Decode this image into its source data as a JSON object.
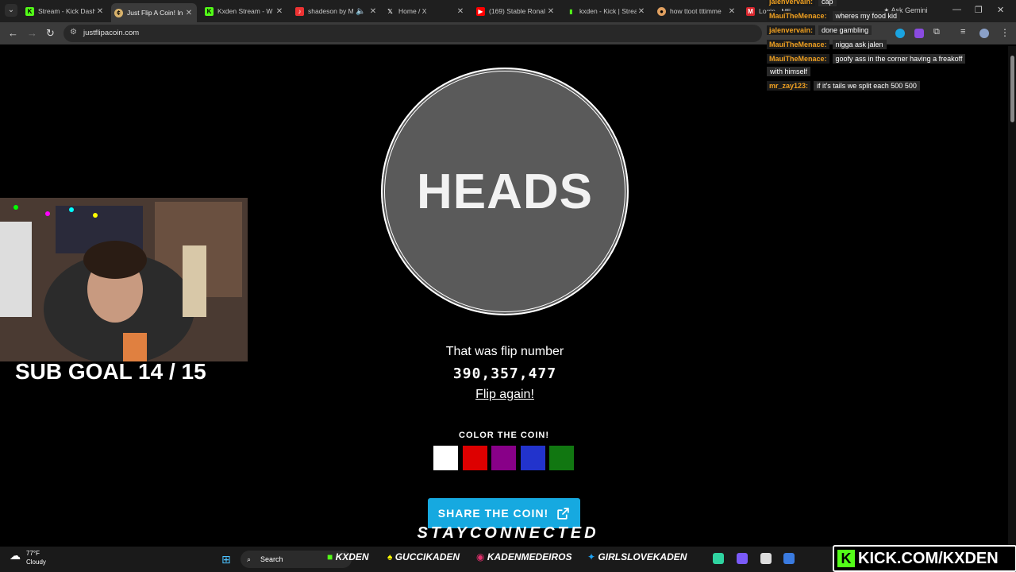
{
  "browser": {
    "tabs": [
      {
        "title": "Stream - Kick Dash",
        "icon": "kick-icon",
        "color": "#53fc18"
      },
      {
        "title": "Just Flip A Coin! In",
        "icon": "coin-icon",
        "color": "#d9b36c"
      },
      {
        "title": "Kxden Stream - W",
        "icon": "kick-icon",
        "color": "#53fc18"
      },
      {
        "title": "shadeson by M",
        "icon": "music-icon",
        "color": "#e33"
      },
      {
        "title": "Home / X",
        "icon": "x-icon",
        "color": "#ffffff"
      },
      {
        "title": "(169) Stable Ronal",
        "icon": "youtube-icon",
        "color": "#ff0000"
      },
      {
        "title": "kxden - Kick | Strea",
        "icon": "stats-icon",
        "color": "#53fc18"
      },
      {
        "title": "how ttoot tttimme",
        "icon": "web-icon",
        "color": "#e0a060"
      },
      {
        "title": "Login - MEGA",
        "icon": "mega-icon",
        "color": "#d9272e"
      }
    ],
    "url": "justflipacoin.com",
    "gemini_label": "Ask Gemini"
  },
  "coin": {
    "result": "HEADS",
    "flip_label": "That was flip number",
    "flip_number": "390,357,477",
    "flip_again": "Flip again!",
    "color_label": "COLOR THE COIN!",
    "swatches": [
      "#ffffff",
      "#dd0000",
      "#880088",
      "#2233cc",
      "#117711"
    ],
    "share_label": "SHARE THE COIN!"
  },
  "overlay": {
    "sub_goal": "SUB GOAL 14 / 15",
    "stay_connected": "STAYCONNECTED",
    "kick_url": "KICK.COM/KXDEN",
    "socials": [
      "KXDEN",
      "GUCCIKADEN",
      "KADENMEDEIROS",
      "GIRLSLOVEKADEN"
    ]
  },
  "chat": [
    {
      "user": "jalenvervain:",
      "message": "cap"
    },
    {
      "user": "MauiTheMenace:",
      "message": "wheres my food kid"
    },
    {
      "user": "jalenvervain:",
      "message": "done gambling"
    },
    {
      "user": "MauiTheMenace:",
      "message": "nigga ask jalen"
    },
    {
      "user": "MauiTheMenace:",
      "message": "goofy ass in the corner having a freakoff"
    },
    {
      "user": "",
      "message": "with himself"
    },
    {
      "user": "mr_zay123:",
      "message": "if it's tails we split each 500 500"
    }
  ],
  "taskbar": {
    "temp": "77°F",
    "condition": "Cloudy",
    "search": "Search"
  }
}
